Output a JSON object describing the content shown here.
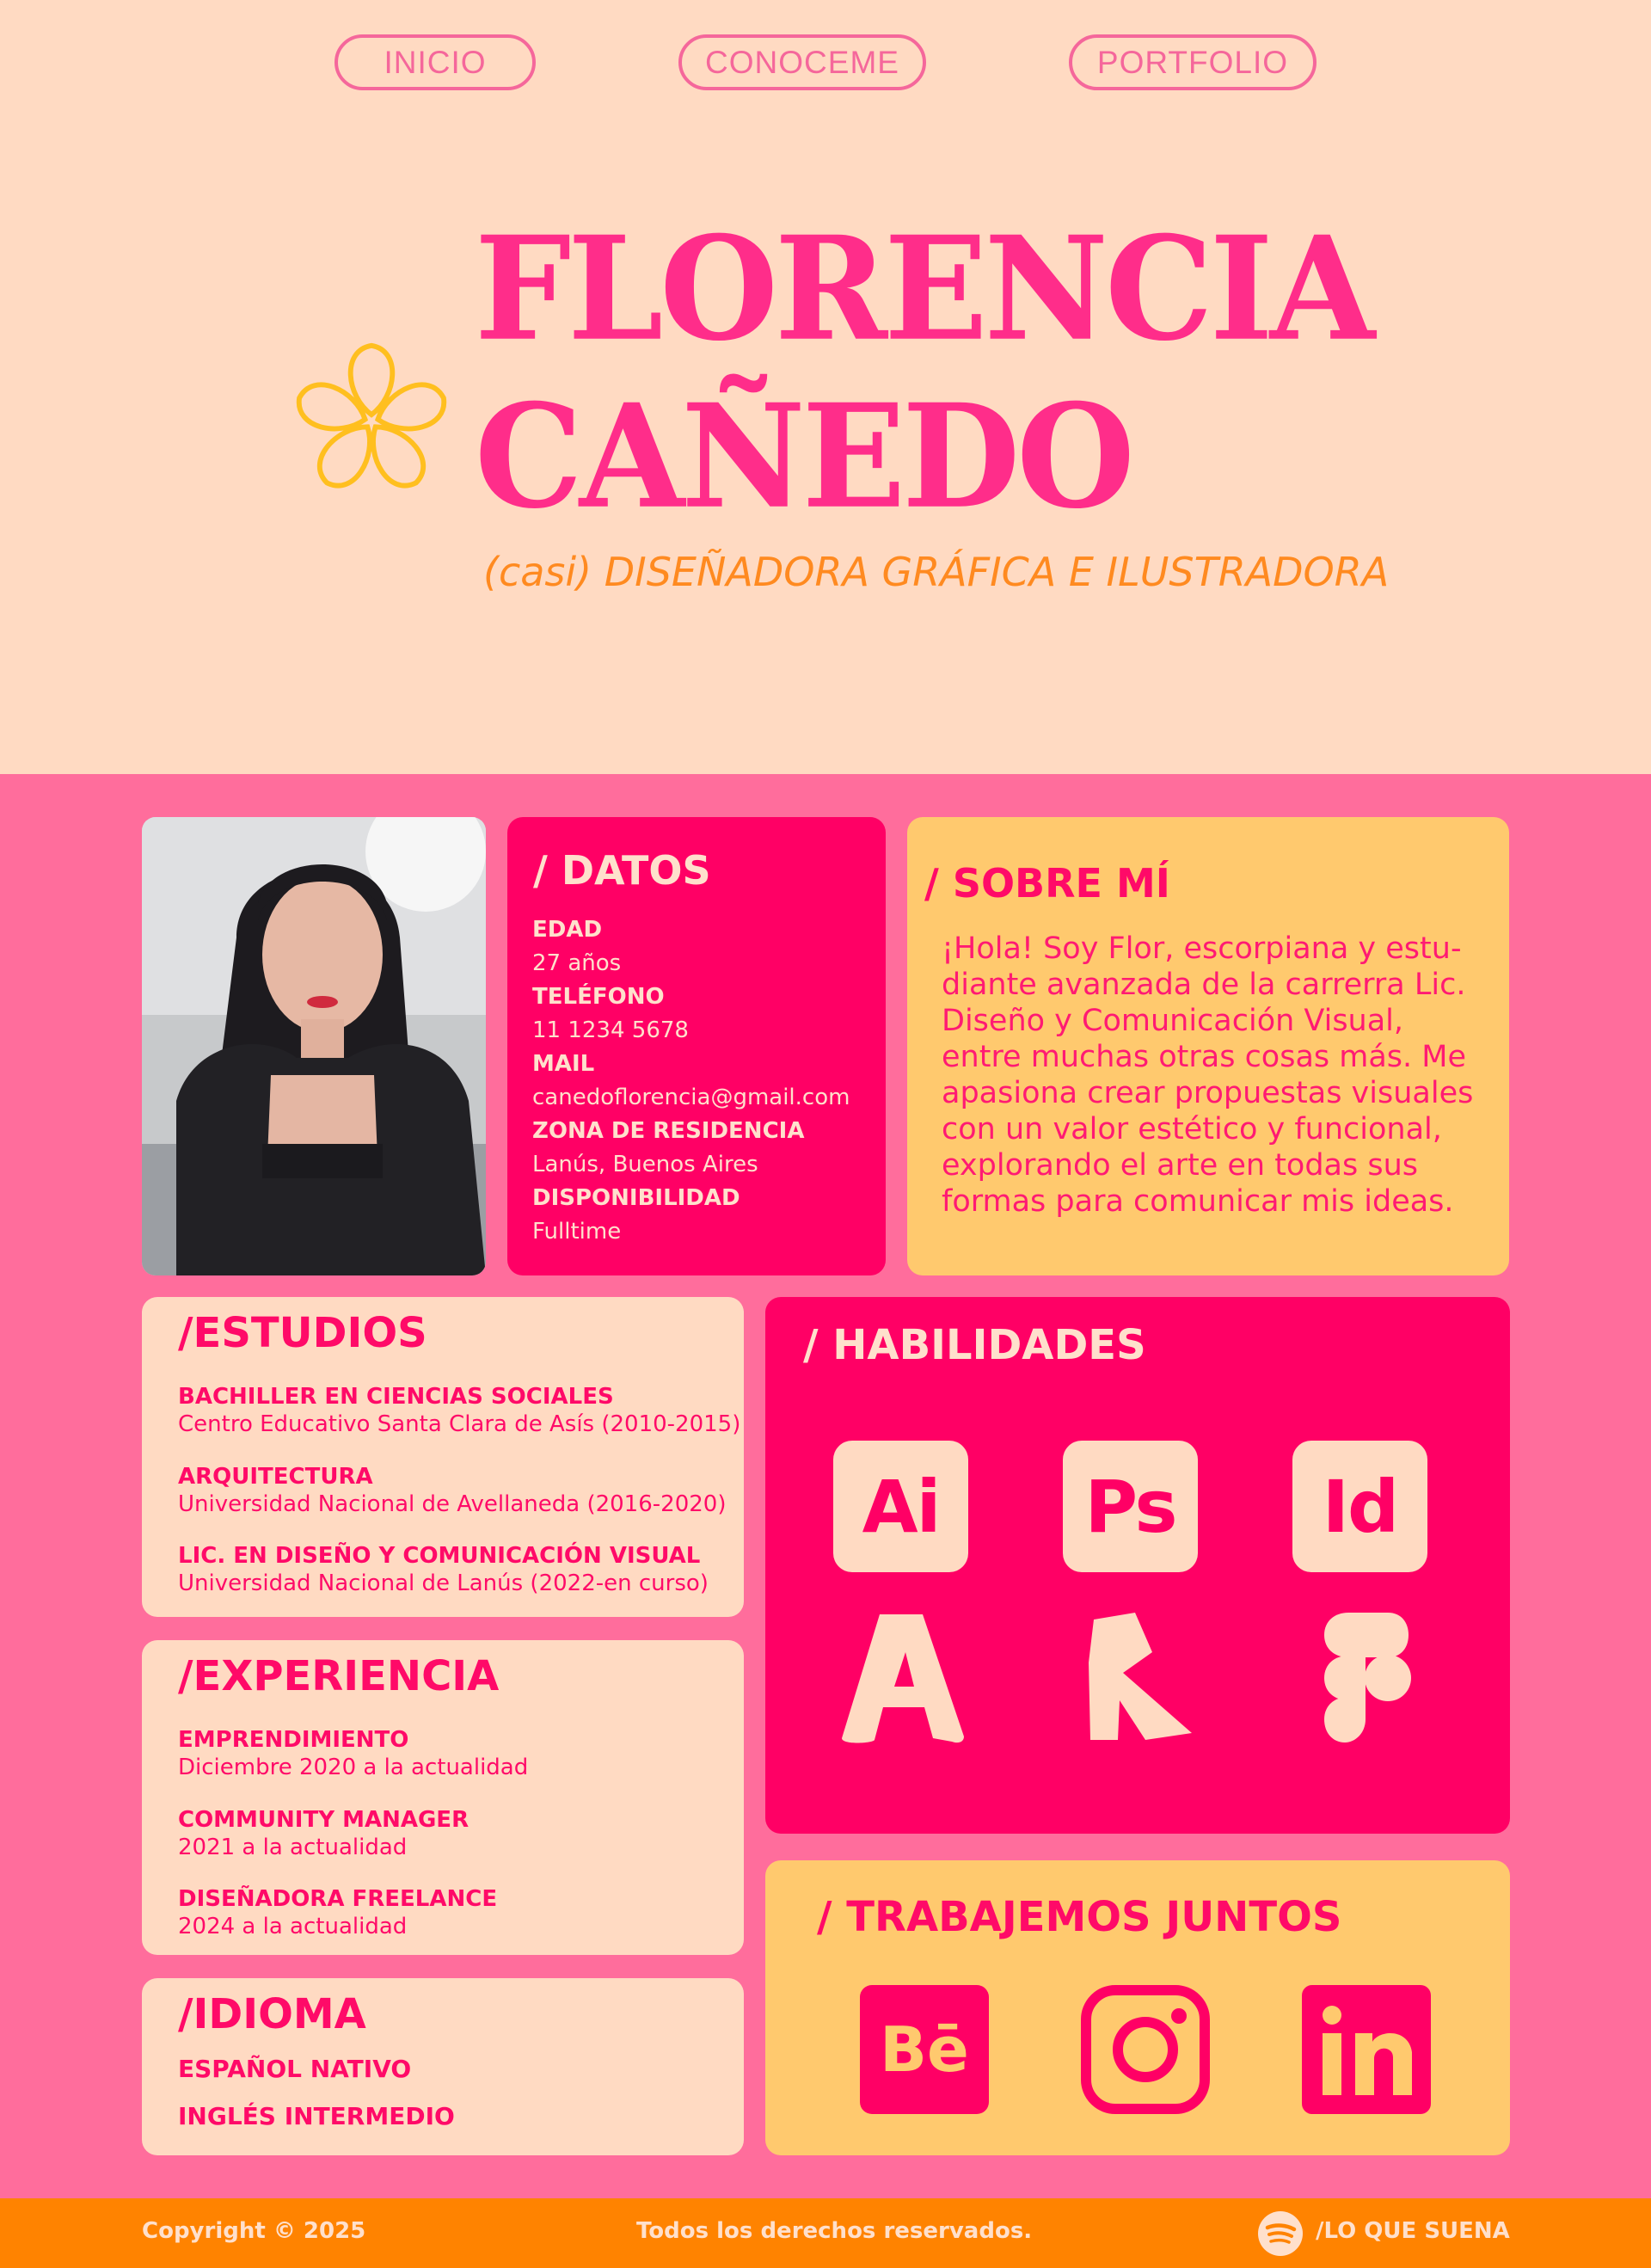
{
  "nav": {
    "items": [
      {
        "label": "INICIO"
      },
      {
        "label": "CONOCEME"
      },
      {
        "label": "PORTFOLIO"
      }
    ]
  },
  "hero": {
    "name_line1": "FLORENCIA",
    "name_line2": "CAÑEDO",
    "subtitle": "(casi) DISEÑADORA GRÁFICA E ILUSTRADORA",
    "flower_icon": "flower-outline-icon"
  },
  "datos": {
    "title": "/ DATOS",
    "fields": [
      {
        "label": "EDAD",
        "value": "27 años"
      },
      {
        "label": "TELÉFONO",
        "value": "11 1234 5678"
      },
      {
        "label": "MAIL",
        "value": "canedoflorencia@gmail.com"
      },
      {
        "label": "ZONA DE RESIDENCIA",
        "value": "Lanús, Buenos Aires"
      },
      {
        "label": "DISPONIBILIDAD",
        "value": "Fulltime"
      }
    ]
  },
  "sobre": {
    "title": "/ SOBRE MÍ",
    "lines": [
      "¡Hola! Soy Flor, escorpiana y estu-",
      "diante avanzada de la carrerra Lic.",
      "Diseño y Comunicación Visual,",
      "entre muchas otras cosas más. Me",
      "apasiona crear propuestas visuales",
      "con un valor estético y funcional,",
      "explorando el arte en todas sus",
      "formas para comunicar mis ideas."
    ]
  },
  "estudios": {
    "title": "/ESTUDIOS",
    "items": [
      {
        "title": "BACHILLER EN CIENCIAS SOCIALES",
        "sub": "Centro Educativo Santa Clara de Asís (2010-2015)"
      },
      {
        "title": "ARQUITECTURA",
        "sub": "Universidad Nacional de Avellaneda (2016-2020)"
      },
      {
        "title": "LIC. EN DISEÑO Y COMUNICACIÓN VISUAL",
        "sub": "Universidad Nacional de Lanús (2022-en curso)"
      }
    ]
  },
  "experiencia": {
    "title": "/EXPERIENCIA",
    "items": [
      {
        "title": "EMPRENDIMIENTO",
        "sub": "Diciembre 2020 a la actualidad"
      },
      {
        "title": "COMMUNITY MANAGER",
        "sub": "2021 a la actualidad"
      },
      {
        "title": "DISEÑADORA FREELANCE",
        "sub": "2024 a la actualidad"
      }
    ]
  },
  "idioma": {
    "title": "/IDIOMA",
    "items": [
      "ESPAÑOL NATIVO",
      "INGLÉS INTERMEDIO"
    ]
  },
  "habilidades": {
    "title": "/ HABILIDADES",
    "apps": [
      {
        "label": "Ai",
        "icon": "illustrator-icon"
      },
      {
        "label": "Ps",
        "icon": "photoshop-icon"
      },
      {
        "label": "Id",
        "icon": "indesign-icon"
      }
    ],
    "logos": [
      "acrobat-icon",
      "procreate-icon",
      "figma-icon"
    ]
  },
  "trabajemos": {
    "title": "/ TRABAJEMOS JUNTOS",
    "socials": [
      "behance-icon",
      "instagram-icon",
      "linkedin-icon"
    ]
  },
  "footer": {
    "copyright": "Copyright © 2025",
    "rights": "Todos los derechos reservados.",
    "spotify_label": "/LO QUE SUENA"
  },
  "colors": {
    "peach": "#ffdac2",
    "pink": "#ff6d9c",
    "magenta": "#ff0065",
    "yellow": "#ffc96e",
    "orange": "#ff8300",
    "hot_pink_text": "#ff2d8a"
  }
}
